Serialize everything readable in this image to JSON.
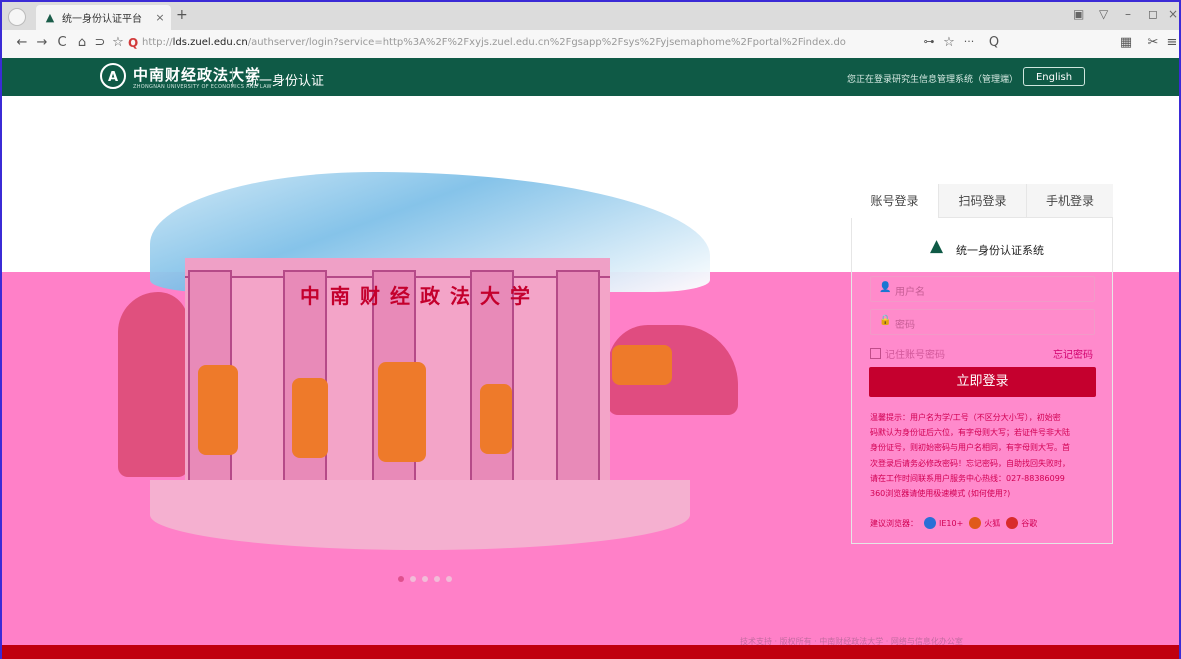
{
  "browser": {
    "tab_title": "统一身份认证平台",
    "tab_close": "×",
    "new_tab": "+",
    "url_prefix": "http://",
    "url_domain": "lds.zuel.edu.cn",
    "url_rest": "/authserver/login?service=http%3A%2F%2Fxyjs.zuel.edu.cn%2Fgsapp%2Fsys%2Fyjsemaphome%2Fportal%2Findex.do",
    "nav": {
      "back": "←",
      "forward": "→",
      "reload": "C",
      "home": "⌂",
      "undo": "⊃",
      "star": "☆"
    },
    "toolbar_right": {
      "key": "⊶",
      "star": "☆",
      "more": "···",
      "search": "Q",
      "grid": "▦",
      "tools": "✂",
      "menu": "≡"
    },
    "window": {
      "minimize": "–",
      "maximize": "◻",
      "close": "×"
    }
  },
  "site_header": {
    "university_name": "中南财经政法大学",
    "university_name_en": "ZHONGNAN UNIVERSITY OF ECONOMICS AND LAW",
    "emblem_letter": "A",
    "system_title": "统一身份认证",
    "notice": "您正在登录研究生信息管理系统（管理端）",
    "language_button": "English"
  },
  "hero": {
    "gate_inscription": "中南财经政法大学",
    "carousel_count": 5,
    "carousel_active": 0
  },
  "login": {
    "tabs": [
      {
        "label": "账号登录",
        "active": true
      },
      {
        "label": "扫码登录",
        "active": false
      },
      {
        "label": "手机登录",
        "active": false
      }
    ],
    "system_icon": "▲",
    "system_name": "统一身份认证系统",
    "username_placeholder": "用户名",
    "password_placeholder": "密码",
    "remember_label": "记住账号密码",
    "forgot_label": "忘记密码",
    "submit_label": "立即登录",
    "tips": [
      "温馨提示：用户名为学/工号（不区分大小写），初始密",
      "码默认为身份证后六位，有字母则大写；若证件号非大陆",
      "身份证号，则初始密码与用户名相同，有字母则大写。首",
      "次登录后请务必修改密码！忘记密码，自助找回失败时，",
      "请在工作时间联系用户服务中心热线：027-88386099",
      "360浏览器请使用极速模式 (如何使用?)"
    ],
    "browsers_label": "建议浏览器：",
    "browsers": [
      {
        "name": "IE10+",
        "color": "#2a6fd6"
      },
      {
        "name": "火狐",
        "color": "#e05a1a"
      },
      {
        "name": "谷歌",
        "color": "#d92b2b"
      }
    ]
  },
  "footer": {
    "text": "技术支持 · 版权所有 · 中南财经政法大学 · 网络与信息化办公室"
  }
}
